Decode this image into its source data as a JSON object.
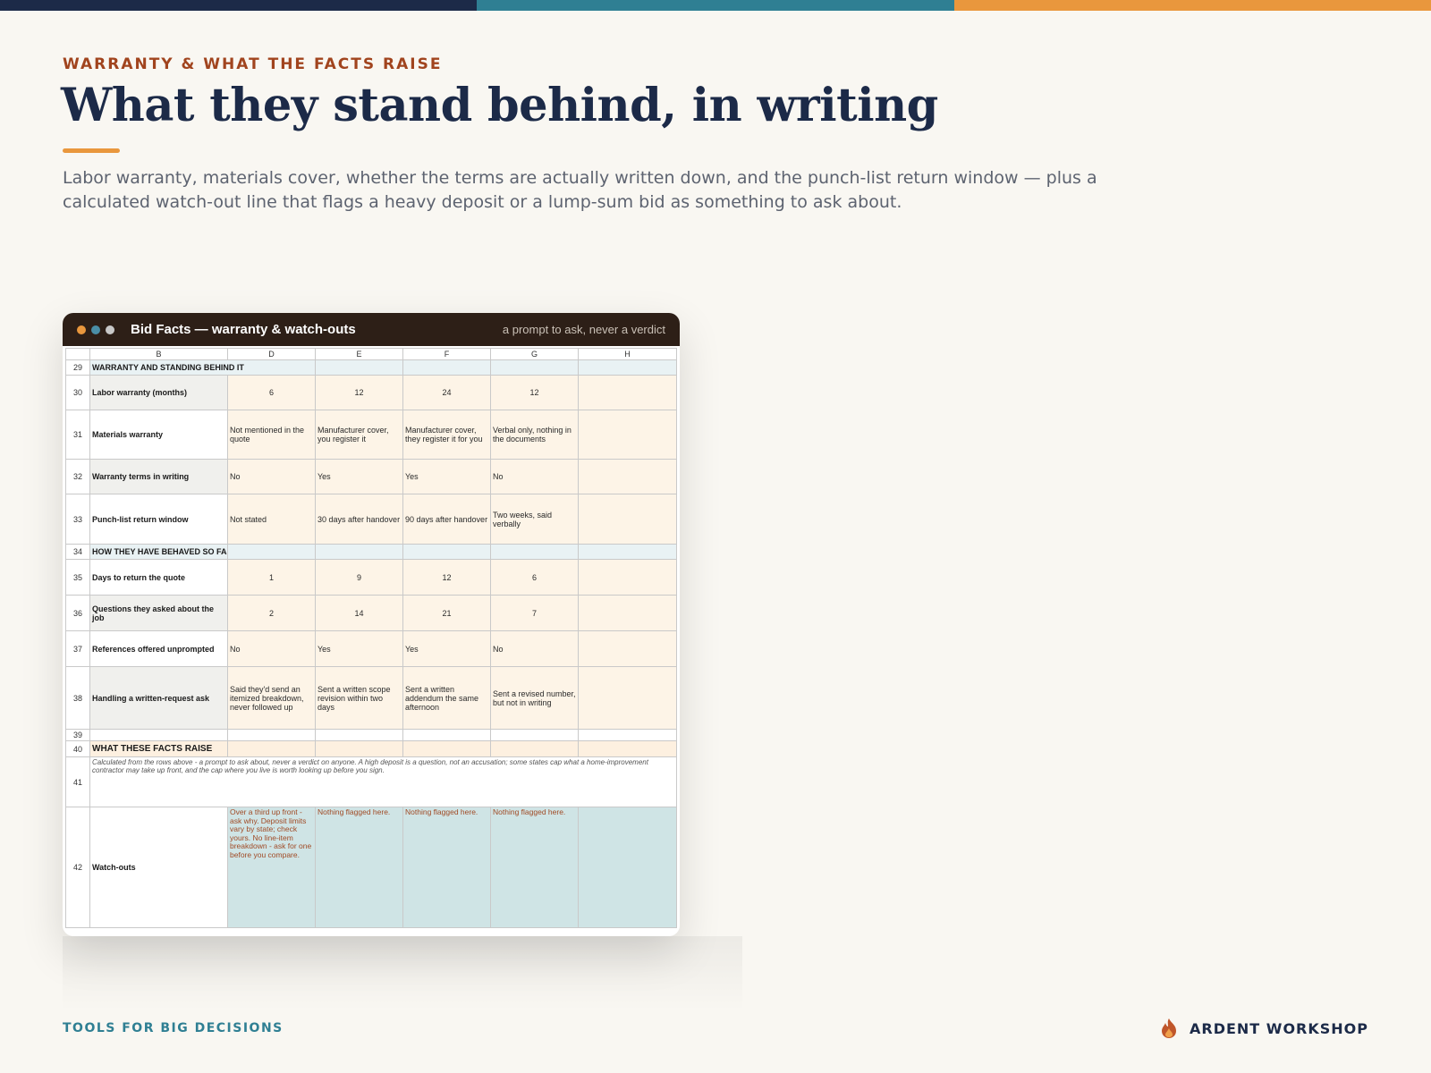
{
  "colors": {
    "navy": "#1c2a48",
    "teal": "#2f7f93",
    "orange": "#e9973d",
    "rust": "#a1441e",
    "window_dark": "#2d1f17",
    "cream_cell": "#fdf4e7",
    "teal_cell": "#cfe4e5"
  },
  "header": {
    "eyebrow": "WARRANTY & WHAT THE FACTS RAISE",
    "title": "What they stand behind, in writing",
    "lede": "Labor warranty, materials cover, whether the terms are actually written down, and the punch-list return window — plus a calculated watch-out line that flags a heavy deposit or a lump-sum bid as something to ask about."
  },
  "window": {
    "title": "Bid Facts — warranty & watch-outs",
    "note": "a prompt to ask, never a verdict",
    "dots": [
      "#e9973d",
      "#4a8ea6",
      "#c8c8c8"
    ]
  },
  "sheet": {
    "columns": [
      "B",
      "D",
      "E",
      "F",
      "G",
      "H"
    ],
    "rows": {
      "r29": {
        "n": "29",
        "label": "WARRANTY AND STANDING BEHIND IT"
      },
      "r30": {
        "n": "30",
        "label": "Labor warranty (months)",
        "d": "6",
        "e": "12",
        "f": "24",
        "g": "12"
      },
      "r31": {
        "n": "31",
        "label": "Materials warranty",
        "d": "Not mentioned in the quote",
        "e": "Manufacturer cover, you register it",
        "f": "Manufacturer cover, they register it for you",
        "g": "Verbal only, nothing in the documents"
      },
      "r32": {
        "n": "32",
        "label": "Warranty terms in writing",
        "d": "No",
        "e": "Yes",
        "f": "Yes",
        "g": "No"
      },
      "r33": {
        "n": "33",
        "label": "Punch-list return window",
        "d": "Not stated",
        "e": "30 days after handover",
        "f": "90 days after handover",
        "g": "Two weeks, said verbally"
      },
      "r34": {
        "n": "34",
        "label": "HOW THEY HAVE BEHAVED SO FAR"
      },
      "r35": {
        "n": "35",
        "label": "Days to return the quote",
        "d": "1",
        "e": "9",
        "f": "12",
        "g": "6"
      },
      "r36": {
        "n": "36",
        "label": "Questions they asked about the job",
        "d": "2",
        "e": "14",
        "f": "21",
        "g": "7"
      },
      "r37": {
        "n": "37",
        "label": "References offered unprompted",
        "d": "No",
        "e": "Yes",
        "f": "Yes",
        "g": "No"
      },
      "r38": {
        "n": "38",
        "label": "Handling a written-request ask",
        "d": "Said they'd send an itemized breakdown, never followed up",
        "e": "Sent a written scope revision within two days",
        "f": "Sent a written addendum the same afternoon",
        "g": "Sent a revised number, but not in writing"
      },
      "r39": {
        "n": "39"
      },
      "r40": {
        "n": "40",
        "label": "WHAT THESE FACTS RAISE"
      },
      "r41": {
        "n": "41",
        "note": "Calculated from the rows above - a prompt to ask about, never a verdict on anyone. A high deposit is a question, not an accusation; some states cap what a home-improvement contractor may take up front, and the cap where you live is worth looking up before you sign."
      },
      "r42": {
        "n": "42",
        "label": "Watch-outs",
        "d": "Over a third up front - ask why. Deposit limits vary by state; check yours. No line-item breakdown - ask for one before you compare.",
        "e": "Nothing flagged here.",
        "f": "Nothing flagged here.",
        "g": "Nothing flagged here."
      }
    }
  },
  "footer": {
    "left": "TOOLS FOR BIG DECISIONS",
    "brand": "ARDENT WORKSHOP",
    "brand_icon": "flame-icon"
  }
}
